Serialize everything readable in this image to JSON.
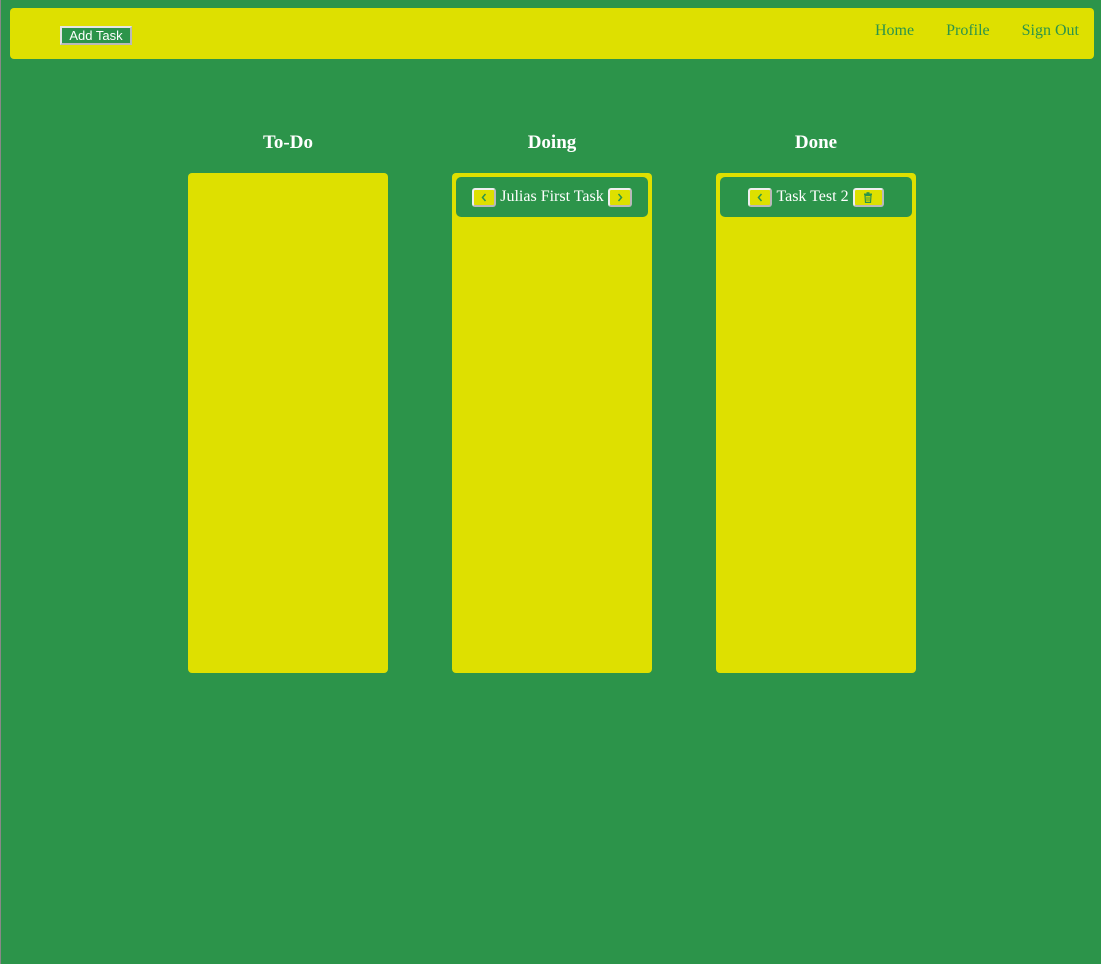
{
  "navbar": {
    "add_task_label": "Add Task",
    "links": [
      "Home",
      "Profile",
      "Sign Out"
    ]
  },
  "columns": [
    {
      "title": "To-Do",
      "tasks": []
    },
    {
      "title": "Doing",
      "tasks": [
        {
          "title": "Julias First Task",
          "left_icon": "chevron-left-icon",
          "right_icon": "chevron-right-icon"
        }
      ]
    },
    {
      "title": "Done",
      "tasks": [
        {
          "title": "Task Test 2",
          "left_icon": "chevron-left-icon",
          "right_icon": "trash-icon"
        }
      ]
    }
  ],
  "colors": {
    "background": "#2c944a",
    "panel": "#dee000",
    "text": "#ffffff"
  }
}
